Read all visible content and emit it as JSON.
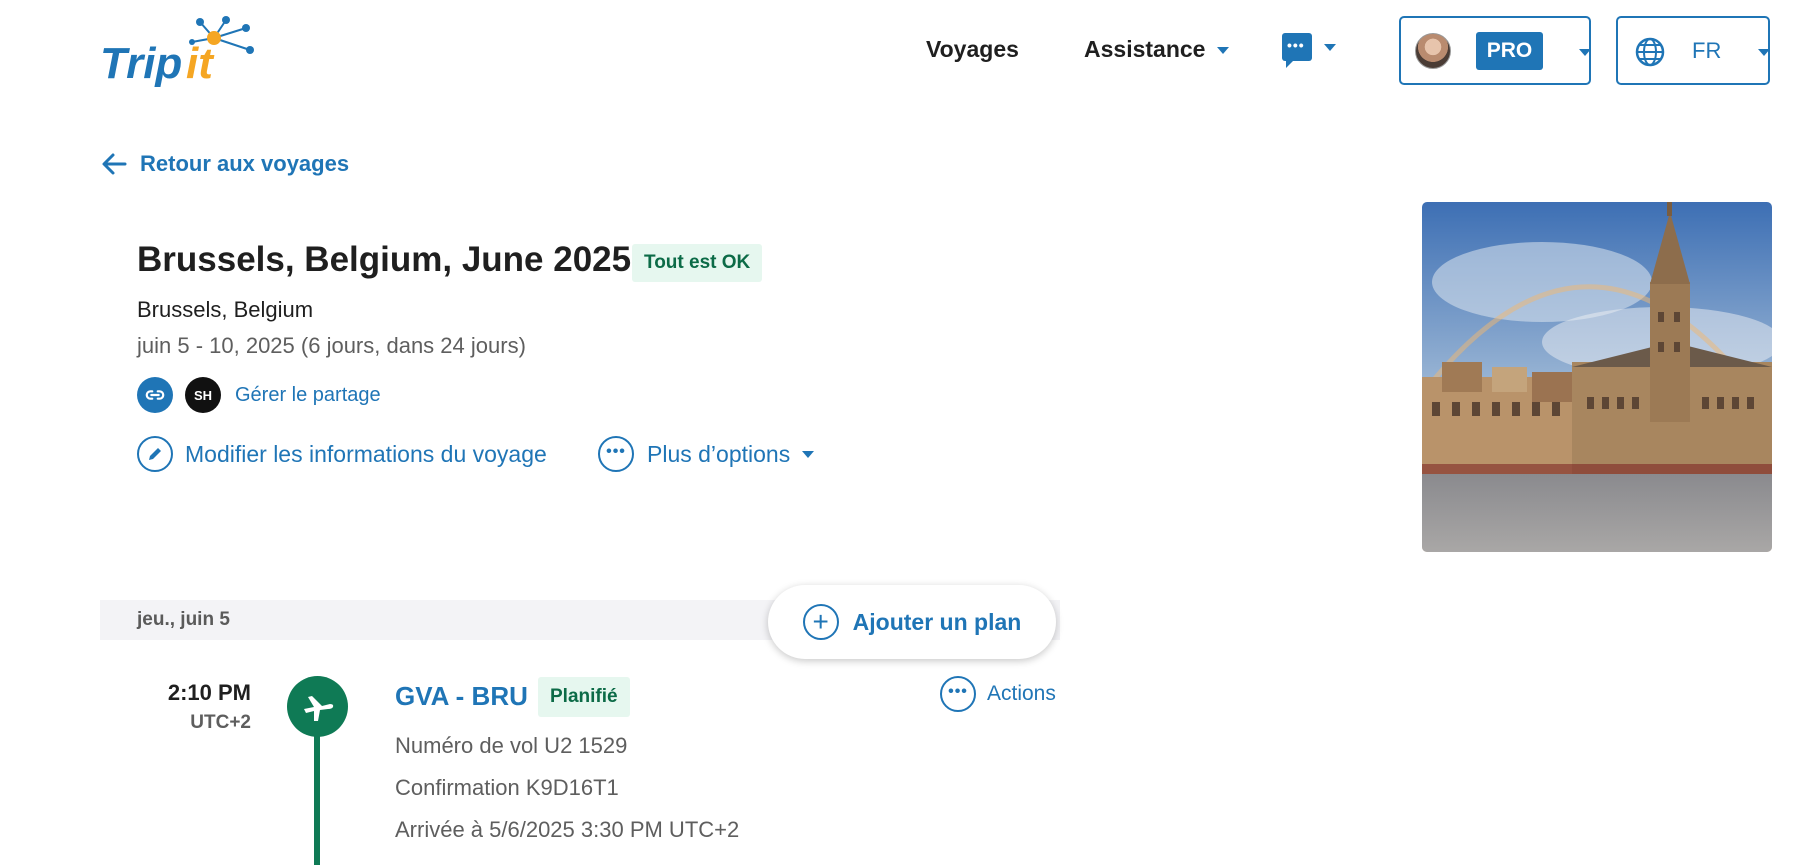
{
  "header": {
    "logo_text": "TripIt",
    "nav": {
      "voyages": "Voyages",
      "assistance": "Assistance"
    },
    "account": {
      "badge": "PRO"
    },
    "language": {
      "code": "FR"
    }
  },
  "back_link": "Retour aux voyages",
  "trip": {
    "title": "Brussels, Belgium, June 2025",
    "status": "Tout est OK",
    "location": "Brussels, Belgium",
    "dates": "juin 5 - 10, 2025 (6 jours, dans 24 jours)",
    "share_initials": "SH",
    "share_link": "Gérer le partage",
    "edit_label": "Modifier les informations du voyage",
    "more_label": "Plus d’options"
  },
  "itinerary": {
    "day_label": "jeu., juin 5",
    "add_plan": "Ajouter un plan",
    "flight": {
      "time": "2:10 PM",
      "timezone": "UTC+2",
      "route": "GVA - BRU",
      "status": "Planifié",
      "actions_label": "Actions",
      "flight_number": "Numéro de vol U2 1529",
      "confirmation": "Confirmation K9D16T1",
      "arrival": "Arrivée à 5/6/2025 3:30 PM UTC+2"
    }
  },
  "colors": {
    "brand_blue": "#1f75b6",
    "logo_orange": "#f5a623",
    "status_green_bg": "#e6f7ef",
    "status_green_text": "#0c6b47",
    "timeline_green": "#0f7a55"
  }
}
